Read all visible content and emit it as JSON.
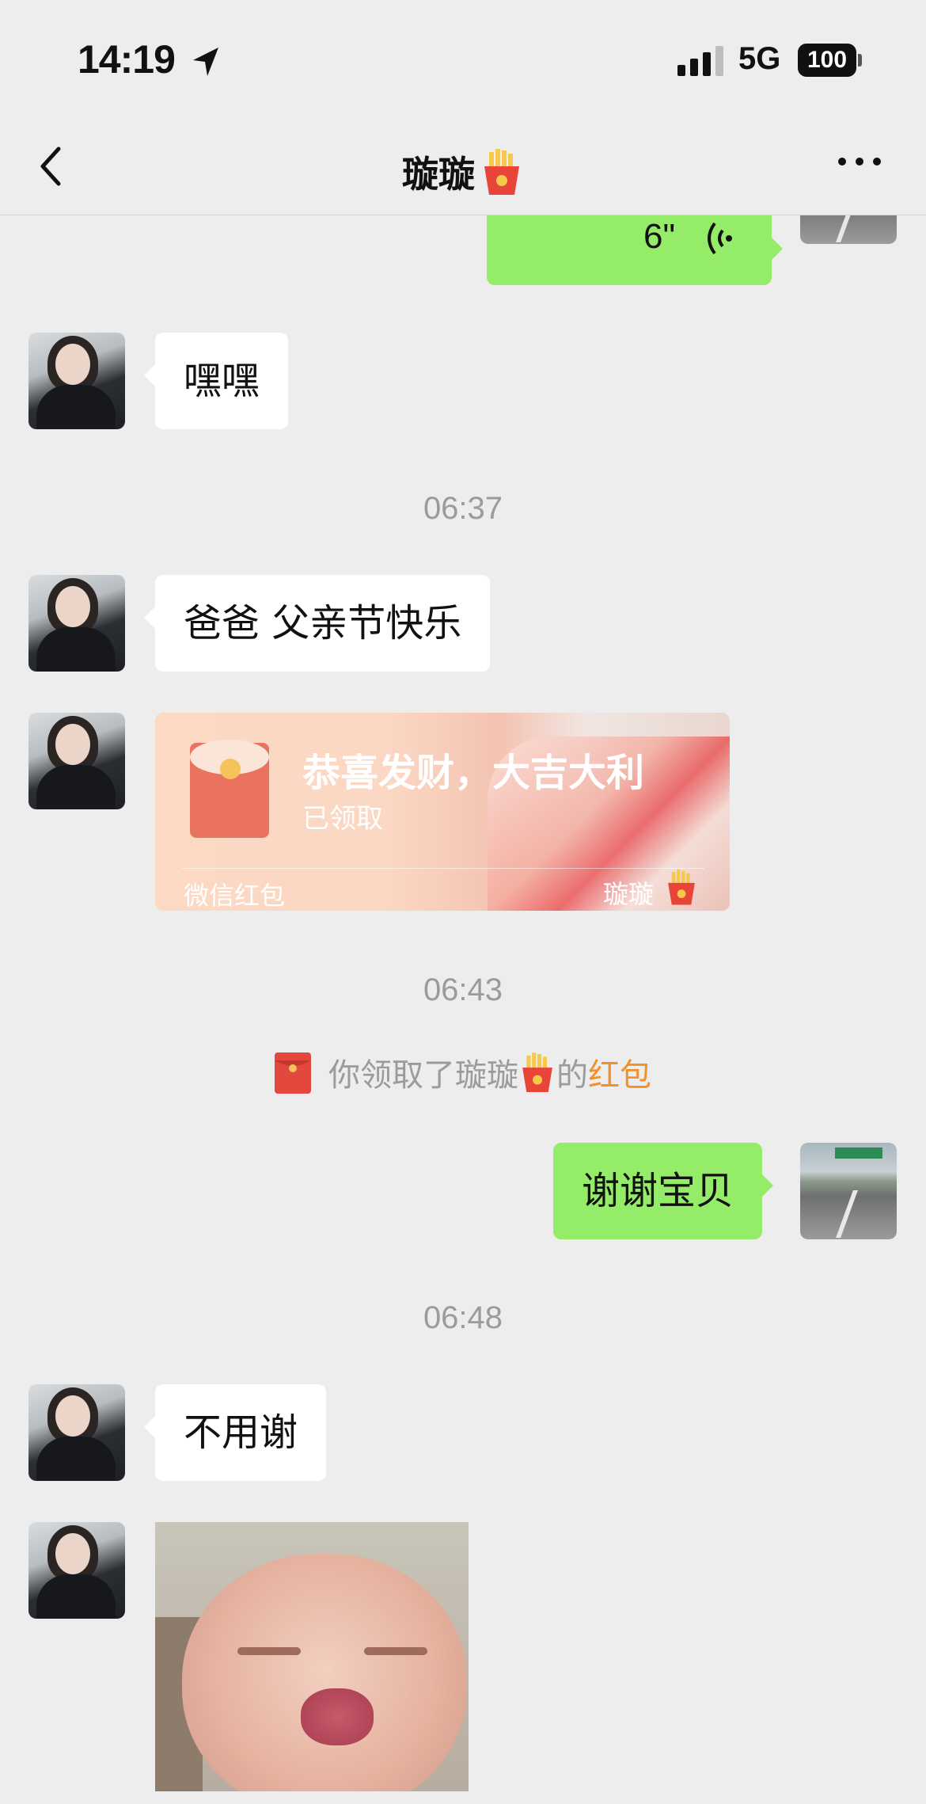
{
  "status_bar": {
    "time": "14:19",
    "network": "5G",
    "battery": "100",
    "icons": [
      "location-arrow-icon",
      "signal-bars-icon",
      "battery-icon"
    ]
  },
  "nav": {
    "title": "璇璇",
    "title_emoji": "french-fries-emoji",
    "back_icon": "chevron-left-icon",
    "more_icon": "ellipsis-icon"
  },
  "messages": {
    "voice": {
      "duration": "6\"",
      "icon": "voice-wave-icon"
    },
    "m1": {
      "text": "嘿嘿"
    },
    "ts1": "06:37",
    "m2": {
      "text": "爸爸 父亲节快乐"
    },
    "red_packet": {
      "title": "恭喜发财，大吉大利",
      "status": "已领取",
      "footer_left": "微信红包",
      "footer_right": "璇璇"
    },
    "ts2": "06:43",
    "system": {
      "prefix": "你领取了璇璇",
      "middle": "的",
      "link": "红包",
      "icon": "red-packet-icon"
    },
    "m3": {
      "text": "谢谢宝贝"
    },
    "ts3": "06:48",
    "m4": {
      "text": "不用谢"
    },
    "sticker": {
      "type": "baby-kiss-sticker"
    }
  },
  "colors": {
    "background": "#ededed",
    "outgoing_bubble": "#95ec69",
    "incoming_bubble": "#ffffff",
    "timestamp": "#9b9b9b",
    "link_orange": "#f0912c"
  }
}
